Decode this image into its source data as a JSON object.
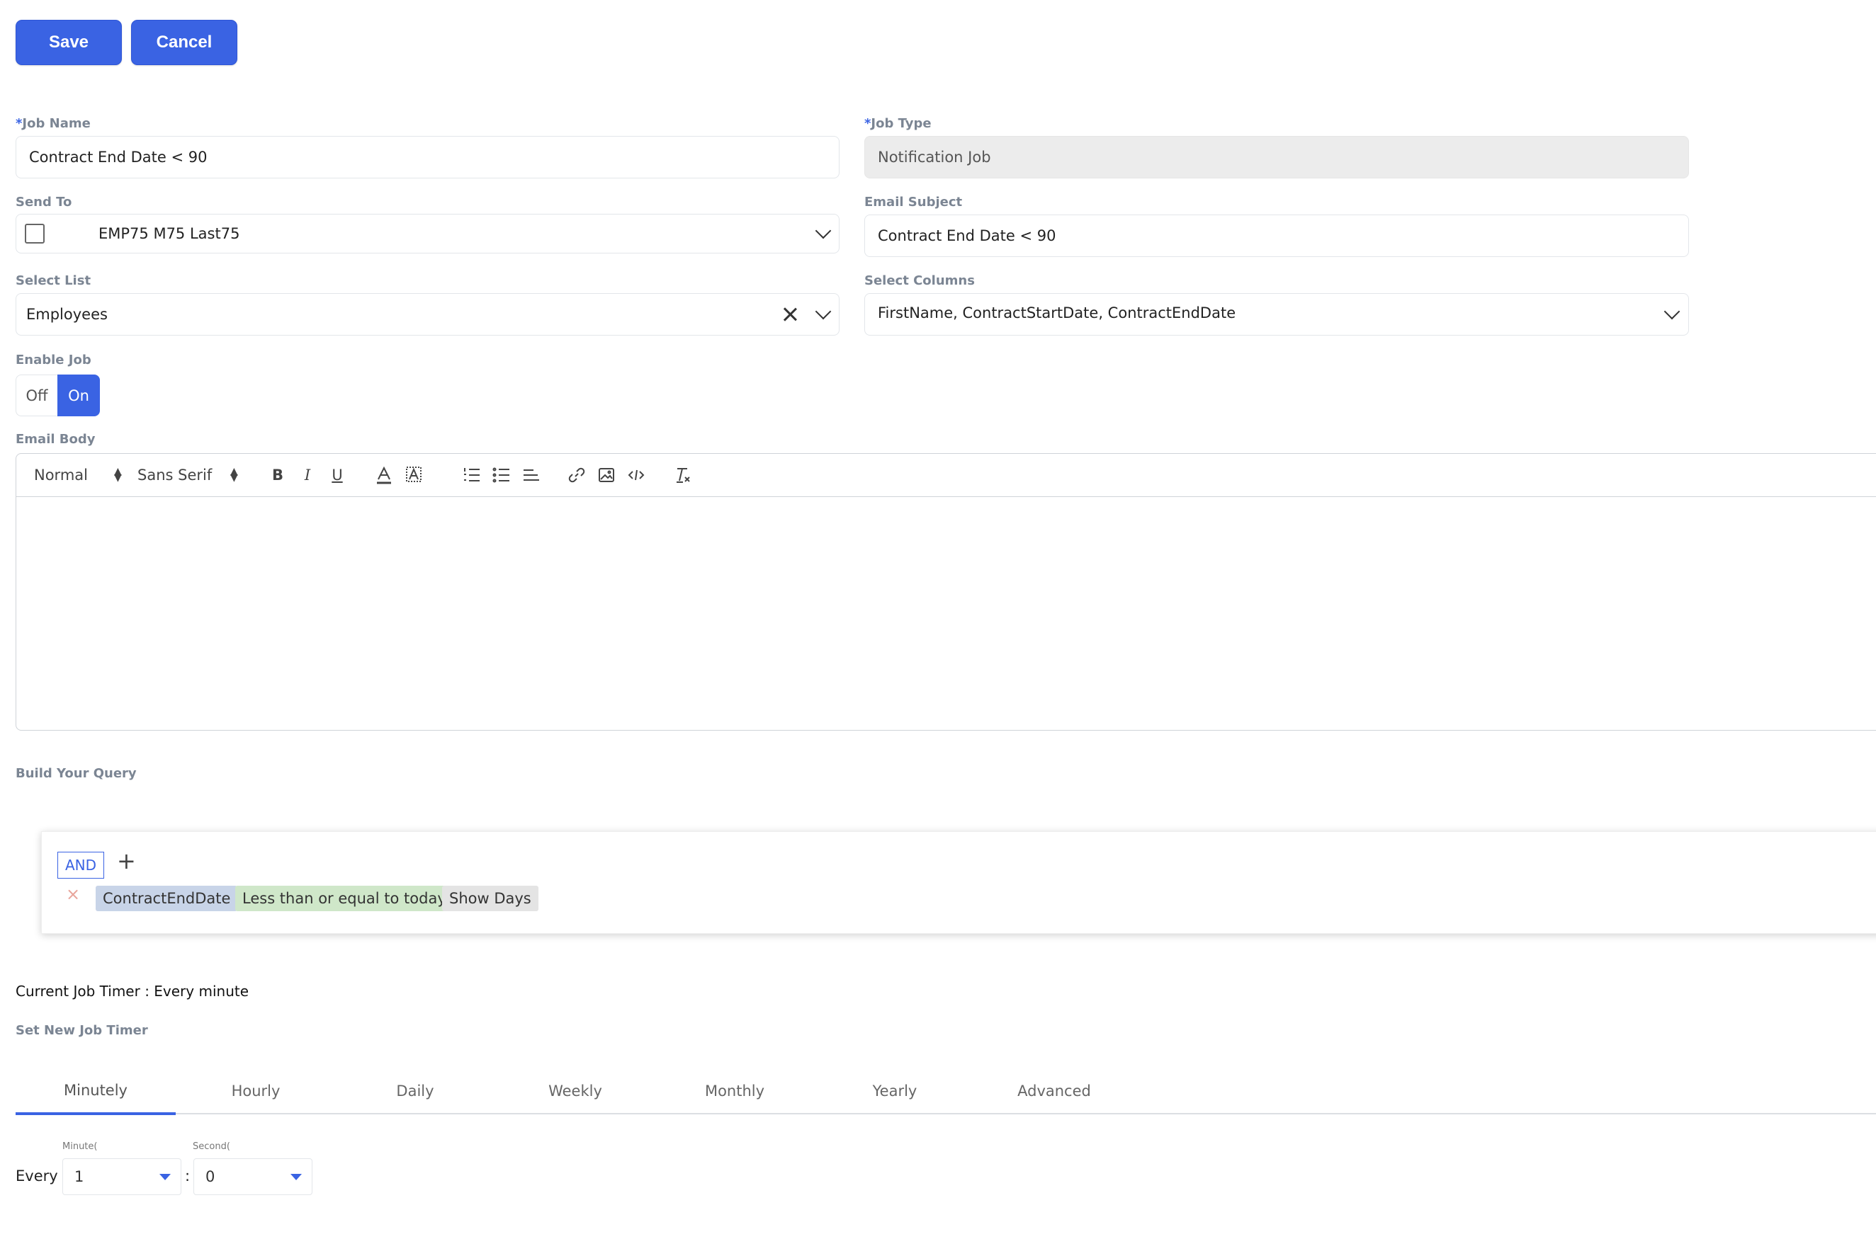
{
  "toolbar": {
    "save_label": "Save",
    "cancel_label": "Cancel"
  },
  "form": {
    "job_name": {
      "label": "Job Name",
      "required_mark": "*",
      "value": "Contract End Date < 90"
    },
    "job_type": {
      "label": "Job Type",
      "required_mark": "*",
      "value": "Notification Job"
    },
    "send_to": {
      "label": "Send To",
      "value": "EMP75 M75 Last75"
    },
    "email_subject": {
      "label": "Email Subject",
      "value": "Contract End Date < 90"
    },
    "select_list": {
      "label": "Select List",
      "value": "Employees"
    },
    "select_columns": {
      "label": "Select Columns",
      "value": "FirstName, ContractStartDate, ContractEndDate"
    },
    "enable_job": {
      "label": "Enable Job",
      "off_label": "Off",
      "on_label": "On",
      "selected": "On"
    },
    "email_body": {
      "label": "Email Body",
      "header_select": "Normal",
      "font_select": "Sans Serif",
      "bold": "B",
      "italic": "I",
      "underline": "U"
    }
  },
  "query": {
    "label": "Build Your Query",
    "combinator": "AND",
    "add_symbol": "+",
    "remove_symbol": "×",
    "rule": {
      "field": "ContractEndDate",
      "operator": "Less than or equal to today",
      "value": "Show Days"
    }
  },
  "timer": {
    "current": "Current Job Timer : Every minute",
    "set_label": "Set New Job Timer",
    "tabs": [
      "Minutely",
      "Hourly",
      "Daily",
      "Weekly",
      "Monthly",
      "Yearly",
      "Advanced"
    ],
    "active_tab": "Minutely",
    "every_label": "Every",
    "minutes_label": "Minute(",
    "seconds_label": "Second(",
    "minutes_value": "1",
    "separator": ":",
    "seconds_value": "0"
  },
  "colors": {
    "accent": "#3a63e3",
    "disabled_bg": "#ececec"
  }
}
